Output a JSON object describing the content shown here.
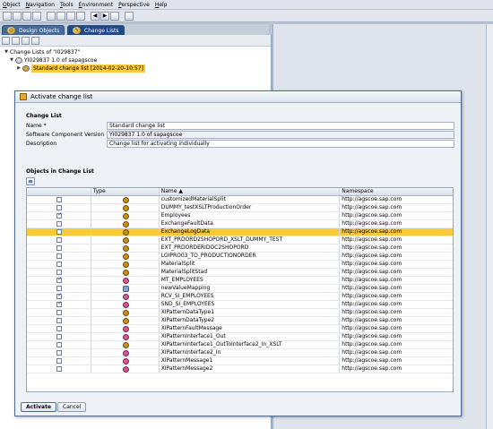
{
  "menu": [
    "Object",
    "Navigation",
    "Tools",
    "Environment",
    "Perspective",
    "Help"
  ],
  "tabs": [
    "Design Objects",
    "Change Lists"
  ],
  "tree": {
    "root": "Change Lists of \"I029837\"",
    "child": "YI029837 1.0 of sapagscoe",
    "selected": "Standard change list [2014-02-20-10:57]"
  },
  "dialog": {
    "title": "Activate change list",
    "section_change_list": "Change List",
    "name_label": "Name *",
    "name_value": "Standard change list",
    "swcv_label": "Software Component Version",
    "swcv_value": "YI029837 1.0 of sapagscoe",
    "desc_label": "Description",
    "desc_value": "Change list for activating individually",
    "section_objects": "Objects in Change List",
    "col_type": "Type",
    "col_name": "Name",
    "col_namespace": "Namespace",
    "activate_btn": "Activate",
    "cancel_btn": "Cancel"
  },
  "rows": [
    {
      "checked": false,
      "icon": "a",
      "name": "customizedMaterialSplit",
      "ns": "http://agscoe.sap.com",
      "hl": false
    },
    {
      "checked": false,
      "icon": "a",
      "name": "DUMMY_testXSLTProductionOrder",
      "ns": "http://agscoe.sap.com",
      "hl": false
    },
    {
      "checked": true,
      "icon": "a",
      "name": "Employees",
      "ns": "http://agscoe.sap.com",
      "hl": false
    },
    {
      "checked": false,
      "icon": "a",
      "name": "ExchangeFaultData",
      "ns": "http://agscoe.sap.com",
      "hl": false
    },
    {
      "checked": false,
      "icon": "a",
      "name": "ExchangeLogData",
      "ns": "http://agscoe.sap.com",
      "hl": true
    },
    {
      "checked": false,
      "icon": "a",
      "name": "EXT_PRDORD2SHOPORD_XSLT_DUMMY_TEST",
      "ns": "http://agscoe.sap.com",
      "hl": false
    },
    {
      "checked": false,
      "icon": "a",
      "name": "EXT_PRDORDERIDOC2SHOPORD",
      "ns": "http://agscoe.sap.com",
      "hl": false
    },
    {
      "checked": false,
      "icon": "a",
      "name": "LOIPRO03_TO_PRODUCTIONORDER",
      "ns": "http://agscoe.sap.com",
      "hl": false
    },
    {
      "checked": false,
      "icon": "a",
      "name": "MaterialSplit",
      "ns": "http://agscoe.sap.com",
      "hl": false
    },
    {
      "checked": false,
      "icon": "a",
      "name": "MaterialSplitStad",
      "ns": "http://agscoe.sap.com",
      "hl": false
    },
    {
      "checked": true,
      "icon": "c",
      "name": "MT_EMPLOYEES",
      "ns": "http://agscoe.sap.com",
      "hl": false
    },
    {
      "checked": false,
      "icon": "b",
      "name": "newValueMapping",
      "ns": "http://agscoe.sap.com",
      "hl": false
    },
    {
      "checked": true,
      "icon": "c",
      "name": "RCV_SI_EMPLOYEES",
      "ns": "http://agscoe.sap.com",
      "hl": false
    },
    {
      "checked": true,
      "icon": "c",
      "name": "SND_SI_EMPLOYEES",
      "ns": "http://agscoe.sap.com",
      "hl": false
    },
    {
      "checked": false,
      "icon": "a",
      "name": "XIPatternDataType1",
      "ns": "http://agscoe.sap.com",
      "hl": false
    },
    {
      "checked": false,
      "icon": "a",
      "name": "XIPatternDataType2",
      "ns": "http://agscoe.sap.com",
      "hl": false
    },
    {
      "checked": false,
      "icon": "c",
      "name": "XIPatternFaultMessage",
      "ns": "http://agscoe.sap.com",
      "hl": false
    },
    {
      "checked": false,
      "icon": "c",
      "name": "XIPatternInterface1_Out",
      "ns": "http://agscoe.sap.com",
      "hl": false
    },
    {
      "checked": false,
      "icon": "a",
      "name": "XIPatternInterface1_OutToInterface2_In_XSLT",
      "ns": "http://agscoe.sap.com",
      "hl": false
    },
    {
      "checked": false,
      "icon": "c",
      "name": "XIPatternInterface2_In",
      "ns": "http://agscoe.sap.com",
      "hl": false
    },
    {
      "checked": false,
      "icon": "c",
      "name": "XIPatternMessage1",
      "ns": "http://agscoe.sap.com",
      "hl": false
    },
    {
      "checked": false,
      "icon": "c",
      "name": "XIPatternMessage2",
      "ns": "http://agscoe.sap.com",
      "hl": false
    }
  ]
}
